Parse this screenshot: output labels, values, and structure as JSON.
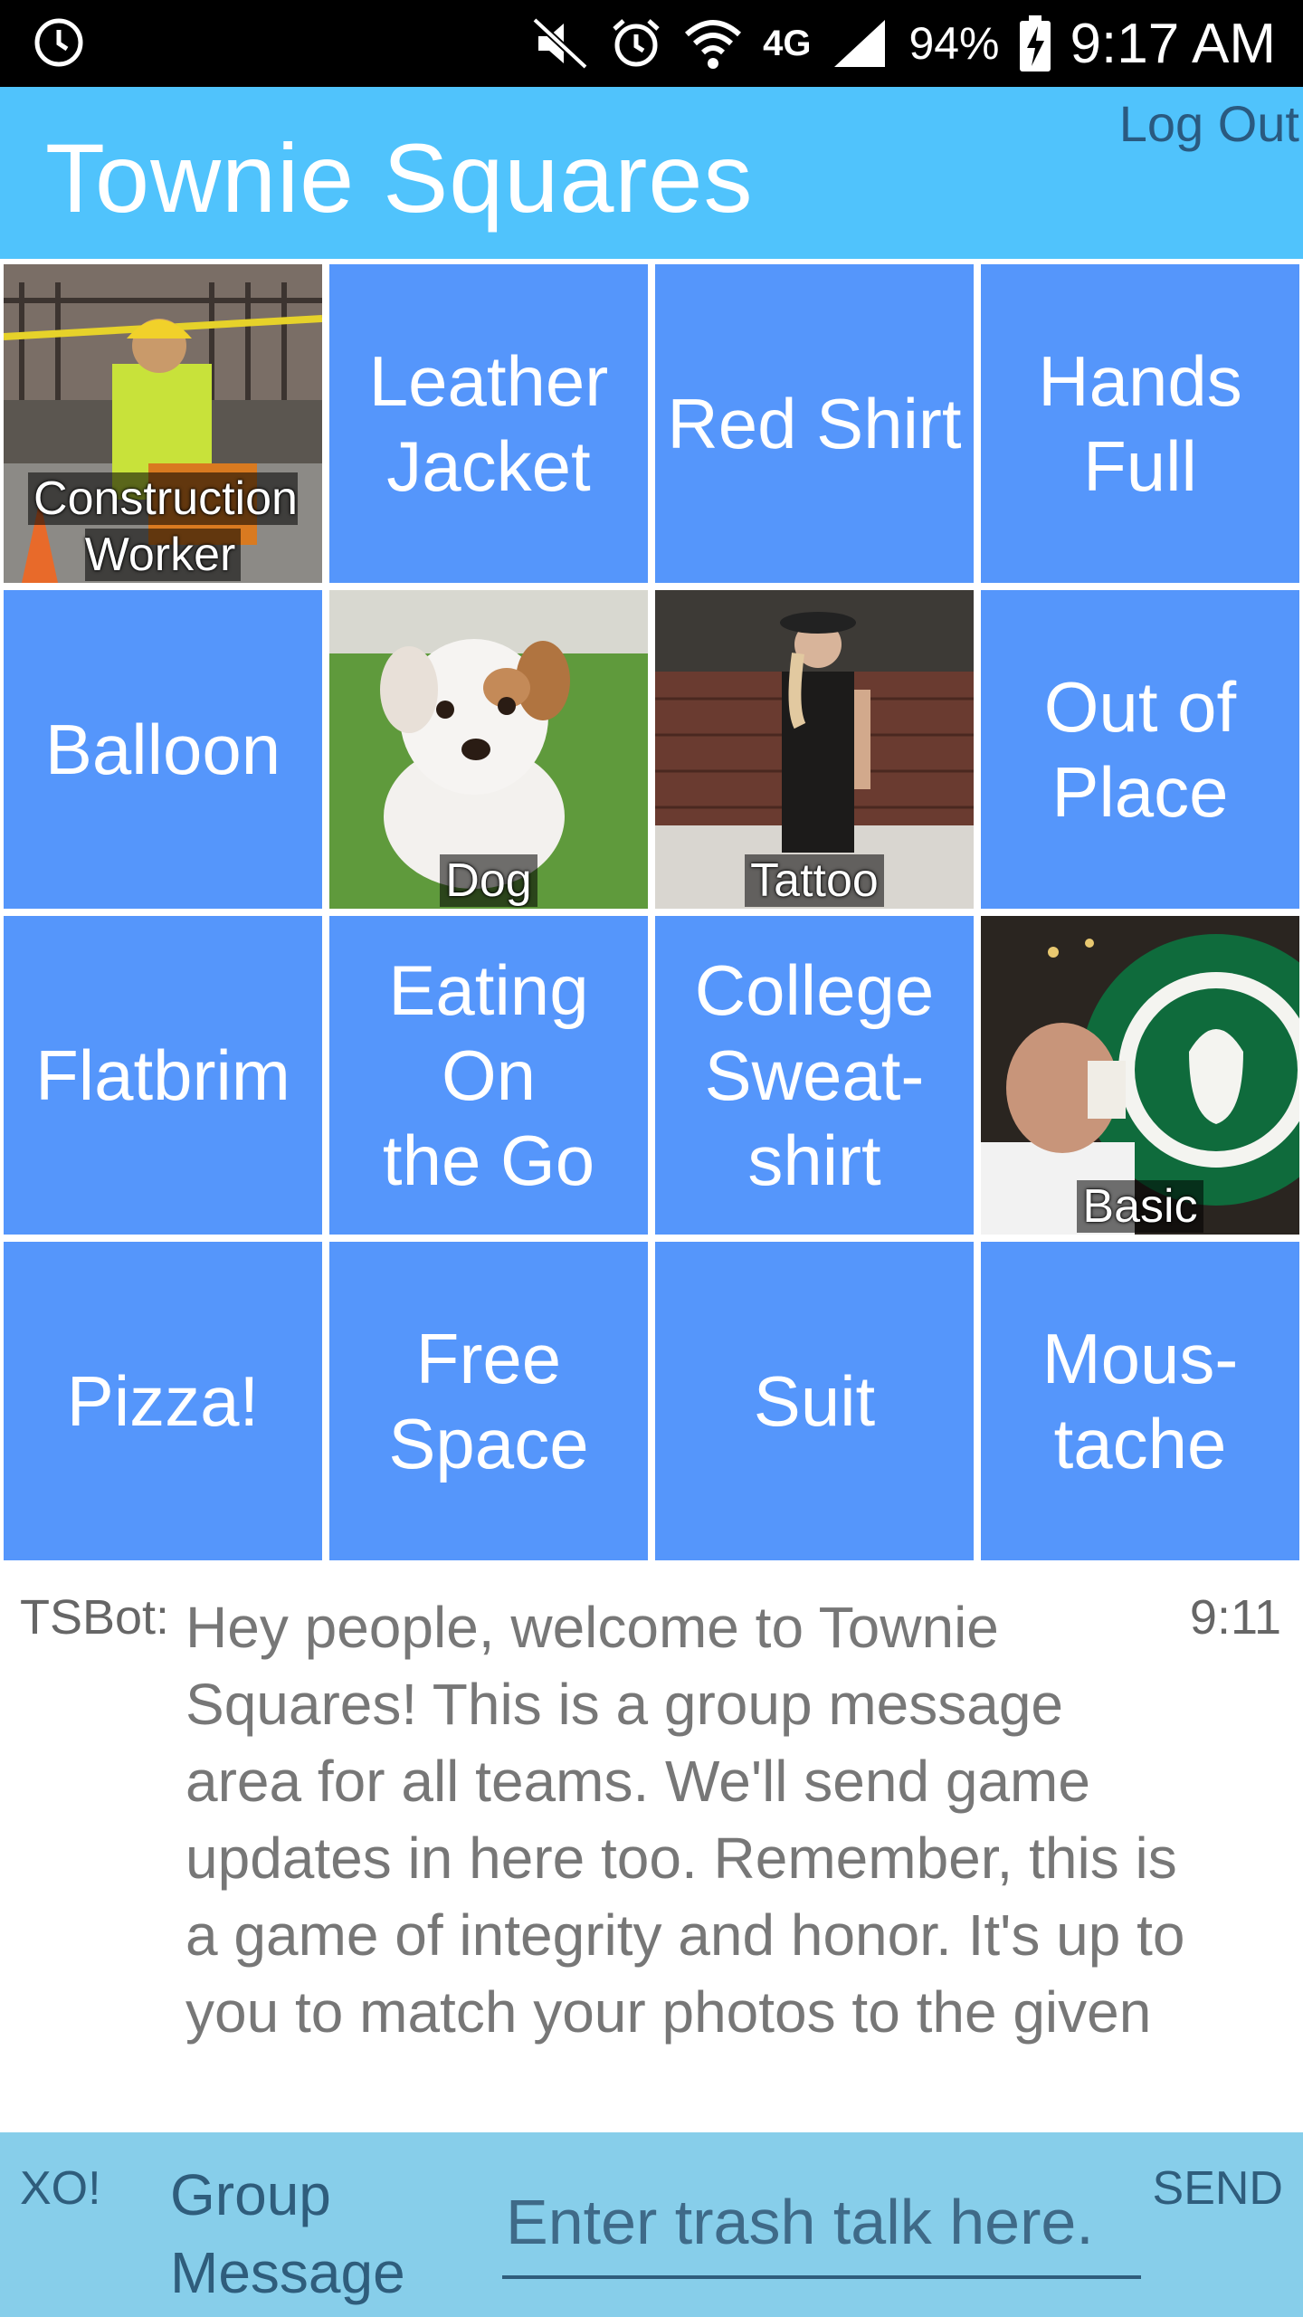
{
  "status_bar": {
    "battery": "94%",
    "time": "9:17 AM",
    "network": "4G",
    "icons": [
      "clock-icon",
      "mute-icon",
      "alarm-icon",
      "wifi-icon",
      "network-4g-icon",
      "signal-icon",
      "battery-charging-icon"
    ]
  },
  "app_bar": {
    "title": "Townie Squares",
    "logout_label": "Log Out",
    "background_color": "#50C3FC"
  },
  "board": {
    "tile_color": "#5596FB",
    "squares": [
      {
        "label": "Construction\nWorker",
        "photo": true
      },
      {
        "label": "Leather\nJacket",
        "photo": false
      },
      {
        "label": "Red Shirt",
        "photo": false
      },
      {
        "label": "Hands\nFull",
        "photo": false
      },
      {
        "label": "Balloon",
        "photo": false
      },
      {
        "label": "Dog",
        "photo": true
      },
      {
        "label": "Tattoo",
        "photo": true
      },
      {
        "label": "Out of\nPlace",
        "photo": false
      },
      {
        "label": "Flatbrim",
        "photo": false
      },
      {
        "label": "Eating On\nthe Go",
        "photo": false
      },
      {
        "label": "College\nSweat-\nshirt",
        "photo": false
      },
      {
        "label": "Basic",
        "photo": true
      },
      {
        "label": "Pizza!",
        "photo": false
      },
      {
        "label": "Free\nSpace",
        "photo": false
      },
      {
        "label": "Suit",
        "photo": false
      },
      {
        "label": "Mous-\ntache",
        "photo": false
      }
    ]
  },
  "chat": {
    "messages": [
      {
        "sender": "TSBot:",
        "time": "9:11",
        "text": "Hey people, welcome to Townie Squares! This is a group message area for all teams. We'll send game updates in here too. Remember, this is a game of integrity and honor. It's up to you to match your photos to the given"
      }
    ]
  },
  "composer": {
    "xo_label": "XO!",
    "group_label": "Group\nMessage",
    "placeholder": "Enter trash talk here.",
    "value": "",
    "send_label": "SEND",
    "background_color": "#87CEEA"
  }
}
